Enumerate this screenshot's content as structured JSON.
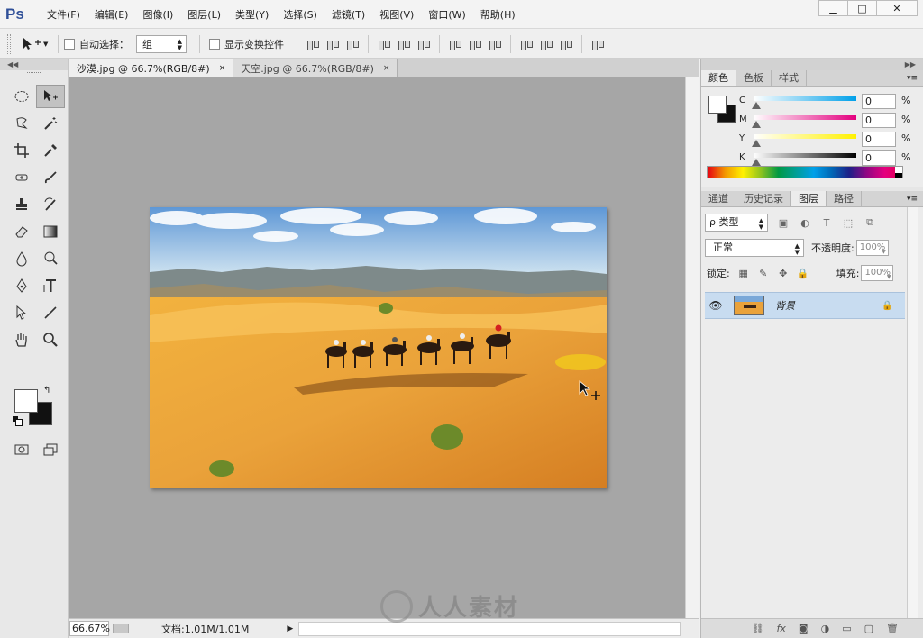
{
  "app": {
    "logo": "Ps"
  },
  "menu": [
    "文件(F)",
    "编辑(E)",
    "图像(I)",
    "图层(L)",
    "类型(Y)",
    "选择(S)",
    "滤镜(T)",
    "视图(V)",
    "窗口(W)",
    "帮助(H)"
  ],
  "window_controls": {
    "minimize": "▁",
    "maximize": "□",
    "close": "✕"
  },
  "options_bar": {
    "tool_icon": "move-tool-icon",
    "auto_select_label": "自动选择：",
    "auto_select_checked": false,
    "auto_select_value": "组",
    "show_transform_label": "显示变换控件",
    "show_transform_checked": false
  },
  "doc_tabs": [
    {
      "label": "沙漠.jpg @ 66.7%(RGB/8#)",
      "active": true
    },
    {
      "label": "天空.jpg @ 66.7%(RGB/8#)",
      "active": false
    }
  ],
  "tab_close": "×",
  "status_bar": {
    "zoom": "66.67%",
    "doc_size": "文档:1.01M/1.01M",
    "arrow": "▶"
  },
  "color_panel": {
    "tabs": [
      "颜色",
      "色板",
      "样式"
    ],
    "active_tab": "颜色",
    "sliders": [
      {
        "label": "C",
        "value": "0",
        "unit": "%",
        "gradient": "#ffffff,#00a0e9"
      },
      {
        "label": "M",
        "value": "0",
        "unit": "%",
        "gradient": "#ffffff,#e4007f"
      },
      {
        "label": "Y",
        "value": "0",
        "unit": "%",
        "gradient": "#ffffff,#fff100"
      },
      {
        "label": "K",
        "value": "0",
        "unit": "%",
        "gradient": "#ffffff,#000000"
      }
    ]
  },
  "layers_panel": {
    "tabs": [
      "通道",
      "历史记录",
      "图层",
      "路径"
    ],
    "active_tab": "图层",
    "filter_label": "ρ 类型",
    "blend_mode": "正常",
    "opacity_label": "不透明度:",
    "opacity_value": "100%",
    "lock_label": "锁定:",
    "fill_label": "填充:",
    "fill_value": "100%",
    "layers": [
      {
        "name": "背景",
        "visible": true,
        "locked": true
      }
    ],
    "footer_icons": [
      "link-icon",
      "fx-icon",
      "mask-icon",
      "adjustment-icon",
      "folder-icon",
      "new-layer-icon",
      "trash-icon"
    ]
  },
  "watermark": "人人素材",
  "colors": {
    "canvas_bg": "#a6a6a6",
    "layer_selected": "#c8dcf0",
    "ps_logo": "#2f4f98"
  }
}
